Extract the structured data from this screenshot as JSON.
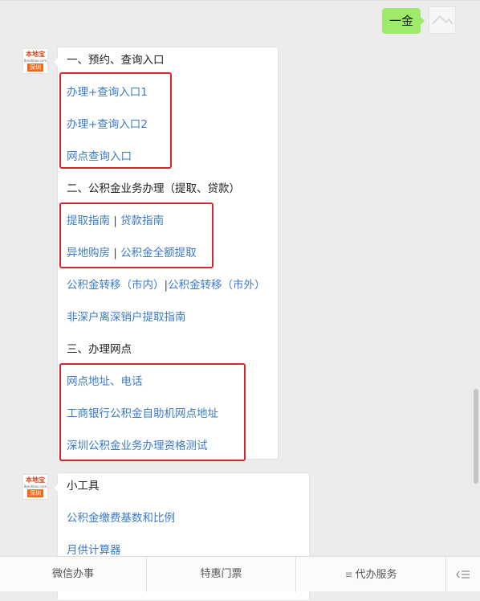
{
  "outgoing": {
    "text": "一金"
  },
  "bot": {
    "logo_top": "本地宝",
    "logo_url": "Bendibao.com",
    "logo_city": "深圳"
  },
  "message1": {
    "section1": "一、预约、查询入口",
    "link_query1": "办理+查询入口1",
    "link_query2": "办理+查询入口2",
    "link_outlet": "网点查询入口",
    "section2": "二、公积金业务办理（提取、贷款）",
    "link_withdraw": "提取指南",
    "link_loan": "贷款指南",
    "link_remote": "异地购房",
    "link_full": "公积金全额提取",
    "link_transfer_in": "公积金转移（市内）",
    "link_transfer_out": "公积金转移（市外）",
    "link_nonlocal": "非深户离深销户提取指南",
    "separator": "|",
    "section3": "三、办理网点",
    "link_address": "网点地址、电话",
    "link_atm": "工商银行公积金自助机网点地址",
    "link_test": "深圳公积金业务办理资格测试"
  },
  "message2": {
    "title": "小工具",
    "link_base": "公积金缴费基数和比例",
    "link_calc": "月供计算器"
  },
  "menu": {
    "item1": "微信办事",
    "item2": "特惠门票",
    "item3": "代办服务",
    "item3_icon": "menu-lines-icon",
    "keyboard_icon": "keyboard-toggle-icon"
  },
  "colors": {
    "link": "#3b7bc9",
    "highlight_box": "#d9262c",
    "outgoing_bubble": "#9eea6a"
  }
}
